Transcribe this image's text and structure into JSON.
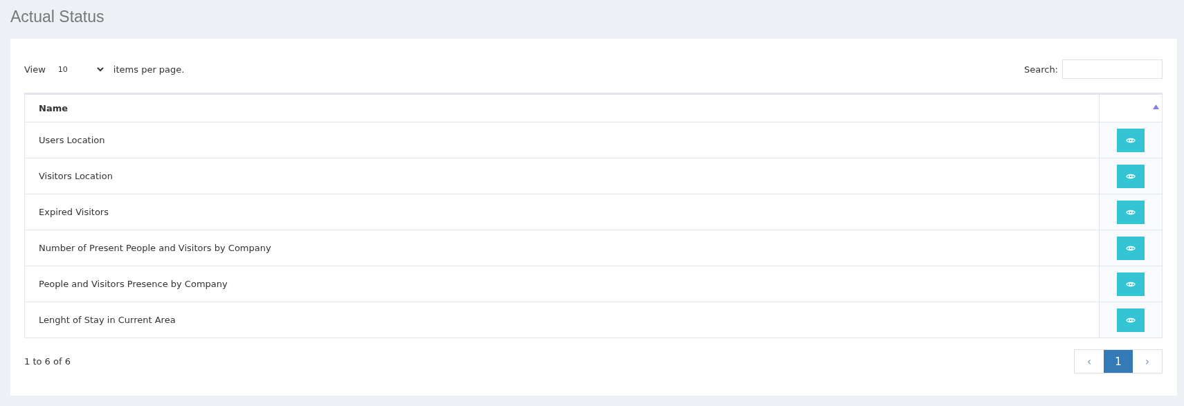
{
  "page_title": "Actual Status",
  "length_control": {
    "prefix": "View",
    "value": "10",
    "suffix": "items per page."
  },
  "search": {
    "label": "Search:"
  },
  "table": {
    "columns": [
      "Name"
    ],
    "sort_ascending": true,
    "rows": [
      {
        "name": "Users Location"
      },
      {
        "name": "Visitors Location"
      },
      {
        "name": "Expired Visitors"
      },
      {
        "name": "Number of Present People and Visitors by Company"
      },
      {
        "name": "People and Visitors Presence by Company"
      },
      {
        "name": "Lenght of Stay in Current Area"
      }
    ]
  },
  "info": "1 to 6 of 6",
  "pagination": {
    "prev": "‹",
    "next": "›",
    "pages": [
      {
        "label": "1",
        "selected": true
      }
    ]
  }
}
